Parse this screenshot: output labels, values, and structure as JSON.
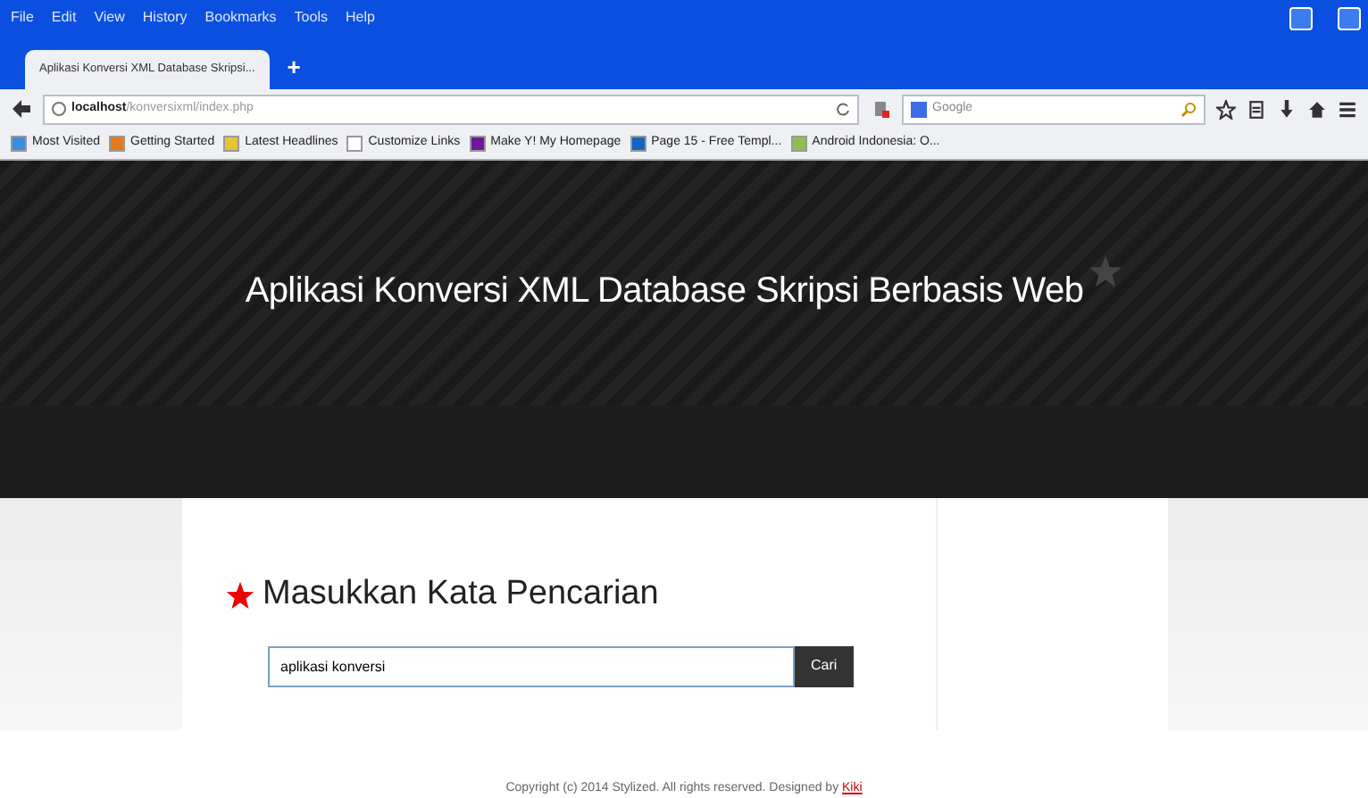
{
  "menu_bar": [
    "File",
    "Edit",
    "View",
    "History",
    "Bookmarks",
    "Tools",
    "Help"
  ],
  "tabs": [
    {
      "label": "Aplikasi Konversi XML Database Skripsi...",
      "selected": true
    }
  ],
  "new_tab": "+",
  "address_bar": {
    "value": "**localhost**/konversixml/index.php"
  },
  "search_bar": {
    "placeholder": "Google"
  },
  "bookmarks": [
    {
      "label": "Most Visited"
    },
    {
      "label": "Getting Started"
    },
    {
      "label": "Latest Headlines"
    },
    {
      "label": "Customize Links"
    },
    {
      "label": "Make Y! My Homepage"
    },
    {
      "label": "Page 15 - Free Templ..."
    },
    {
      "label": "Android Indonesia: O..."
    }
  ],
  "header": {
    "title": "Aplikasi Konversi XML Database Skripsi Berbasis Web"
  },
  "search_form": {
    "heading": "Masukkan Kata Pencarian",
    "value": "aplikasi konversi",
    "button": "Cari"
  },
  "footer": {
    "text": "Copyright (c) 2014 Stylized. All rights reserved. Designed by",
    "link": "Kiki"
  }
}
